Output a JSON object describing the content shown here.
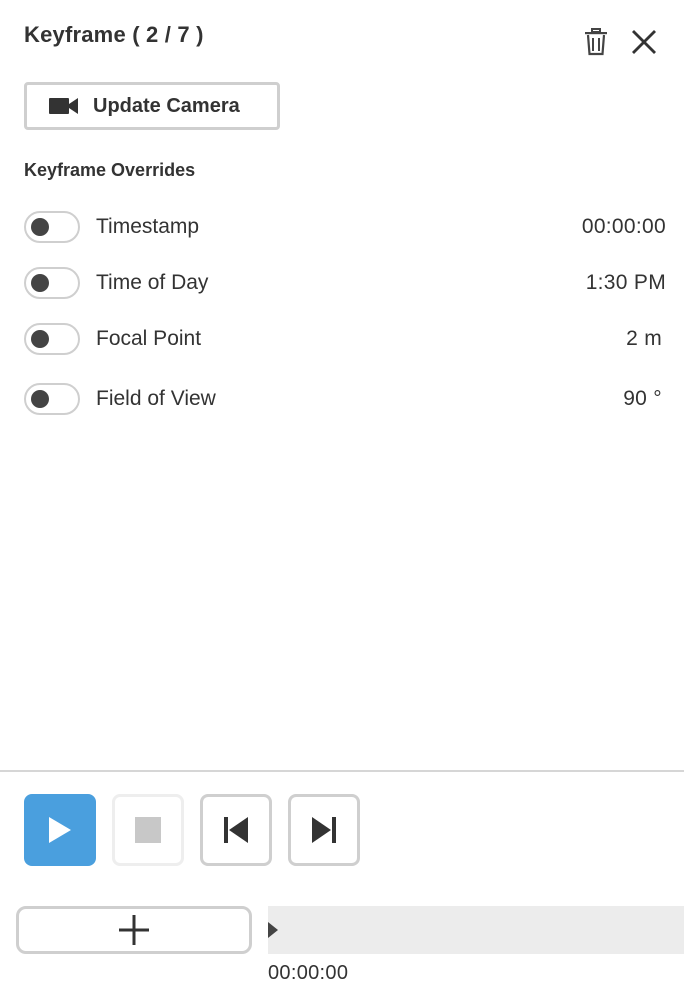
{
  "panel": {
    "title": "Keyframe ( 2 / 7 )",
    "update_camera_label": "Update Camera",
    "section_title": "Keyframe Overrides"
  },
  "overrides": [
    {
      "label": "Timestamp",
      "value": "00:00:00",
      "enabled": false
    },
    {
      "label": "Time of Day",
      "value": "1:30 PM",
      "enabled": false
    },
    {
      "label": "Focal Point",
      "value": "2 m",
      "enabled": false
    },
    {
      "label": "Field of View",
      "value": "90 °",
      "enabled": false
    }
  ],
  "playback": {
    "current_time": "00:00:00"
  },
  "icons": {
    "trash": "trash-icon",
    "close": "close-icon",
    "camera": "video-camera-icon",
    "play": "play-icon",
    "stop": "stop-icon",
    "prev": "skip-previous-icon",
    "next": "skip-next-icon",
    "add": "plus-icon"
  },
  "colors": {
    "accent": "#4a9fde",
    "text": "#333333",
    "border": "#cfcfcf",
    "timeline_bg": "#ececec"
  }
}
